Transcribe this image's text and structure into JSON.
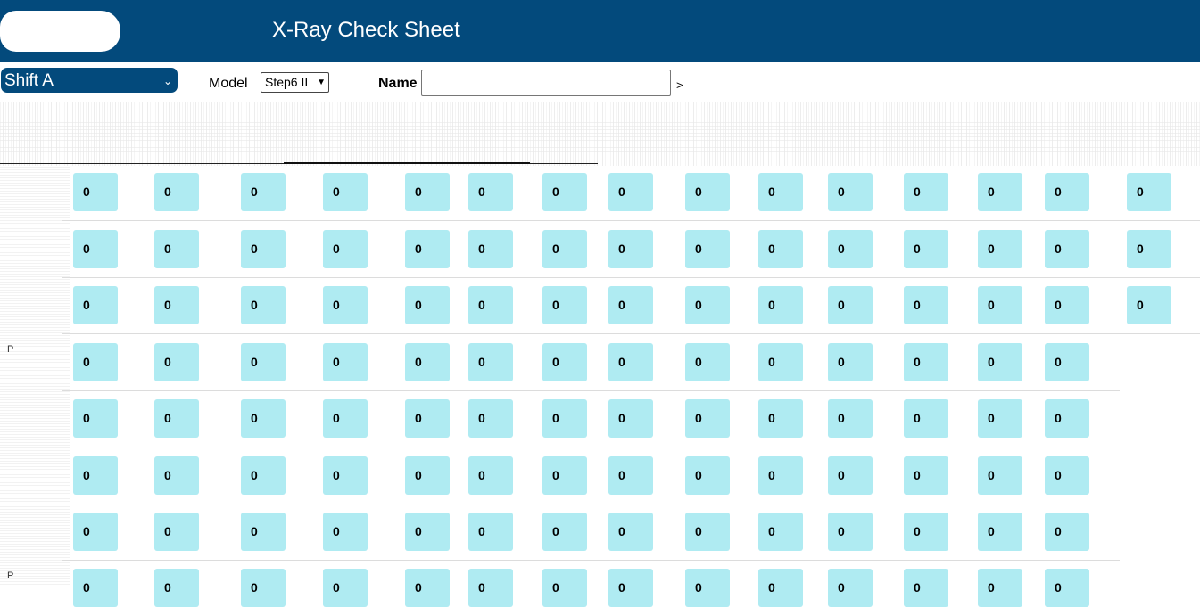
{
  "header": {
    "title": "X-Ray Check Sheet"
  },
  "toolbar": {
    "shift_selected": "Shift A",
    "model_label": "Model",
    "model_selected": "Step6 II",
    "name_label": "Name",
    "name_value": "",
    "arrow_text": ">"
  },
  "side_marks": [
    "P",
    "P"
  ],
  "colors": {
    "header_bg": "#034a7c",
    "cell_bg": "#afebf2"
  },
  "grid": {
    "rows": [
      [
        "0",
        "0",
        "0",
        "0",
        "0",
        "0",
        "0",
        "0",
        "0",
        "0",
        "0",
        "0",
        "0",
        "0",
        "0"
      ],
      [
        "0",
        "0",
        "0",
        "0",
        "0",
        "0",
        "0",
        "0",
        "0",
        "0",
        "0",
        "0",
        "0",
        "0",
        "0"
      ],
      [
        "0",
        "0",
        "0",
        "0",
        "0",
        "0",
        "0",
        "0",
        "0",
        "0",
        "0",
        "0",
        "0",
        "0",
        "0"
      ],
      [
        "0",
        "0",
        "0",
        "0",
        "0",
        "0",
        "0",
        "0",
        "0",
        "0",
        "0",
        "0",
        "0",
        "0"
      ],
      [
        "0",
        "0",
        "0",
        "0",
        "0",
        "0",
        "0",
        "0",
        "0",
        "0",
        "0",
        "0",
        "0",
        "0"
      ],
      [
        "0",
        "0",
        "0",
        "0",
        "0",
        "0",
        "0",
        "0",
        "0",
        "0",
        "0",
        "0",
        "0",
        "0"
      ],
      [
        "0",
        "0",
        "0",
        "0",
        "0",
        "0",
        "0",
        "0",
        "0",
        "0",
        "0",
        "0",
        "0",
        "0"
      ],
      [
        "0",
        "0",
        "0",
        "0",
        "0",
        "0",
        "0",
        "0",
        "0",
        "0",
        "0",
        "0",
        "0",
        "0"
      ]
    ]
  }
}
